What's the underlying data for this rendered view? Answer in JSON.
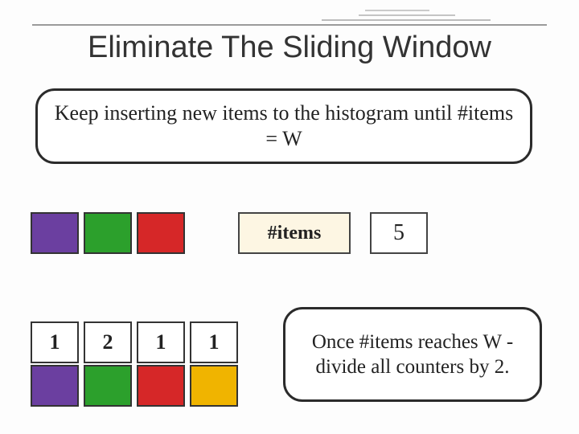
{
  "title": "Eliminate The Sliding Window",
  "top_bubble": "Keep inserting new items to the histogram until #items = W",
  "bottom_bubble": "Once #items reaches W - divide all counters by 2.",
  "items_label": "#items",
  "items_value": "5",
  "top_colors": [
    "purple",
    "green",
    "red"
  ],
  "counts": [
    "1",
    "2",
    "1",
    "1"
  ],
  "bottom_colors": [
    "purple",
    "green",
    "red",
    "orange"
  ]
}
